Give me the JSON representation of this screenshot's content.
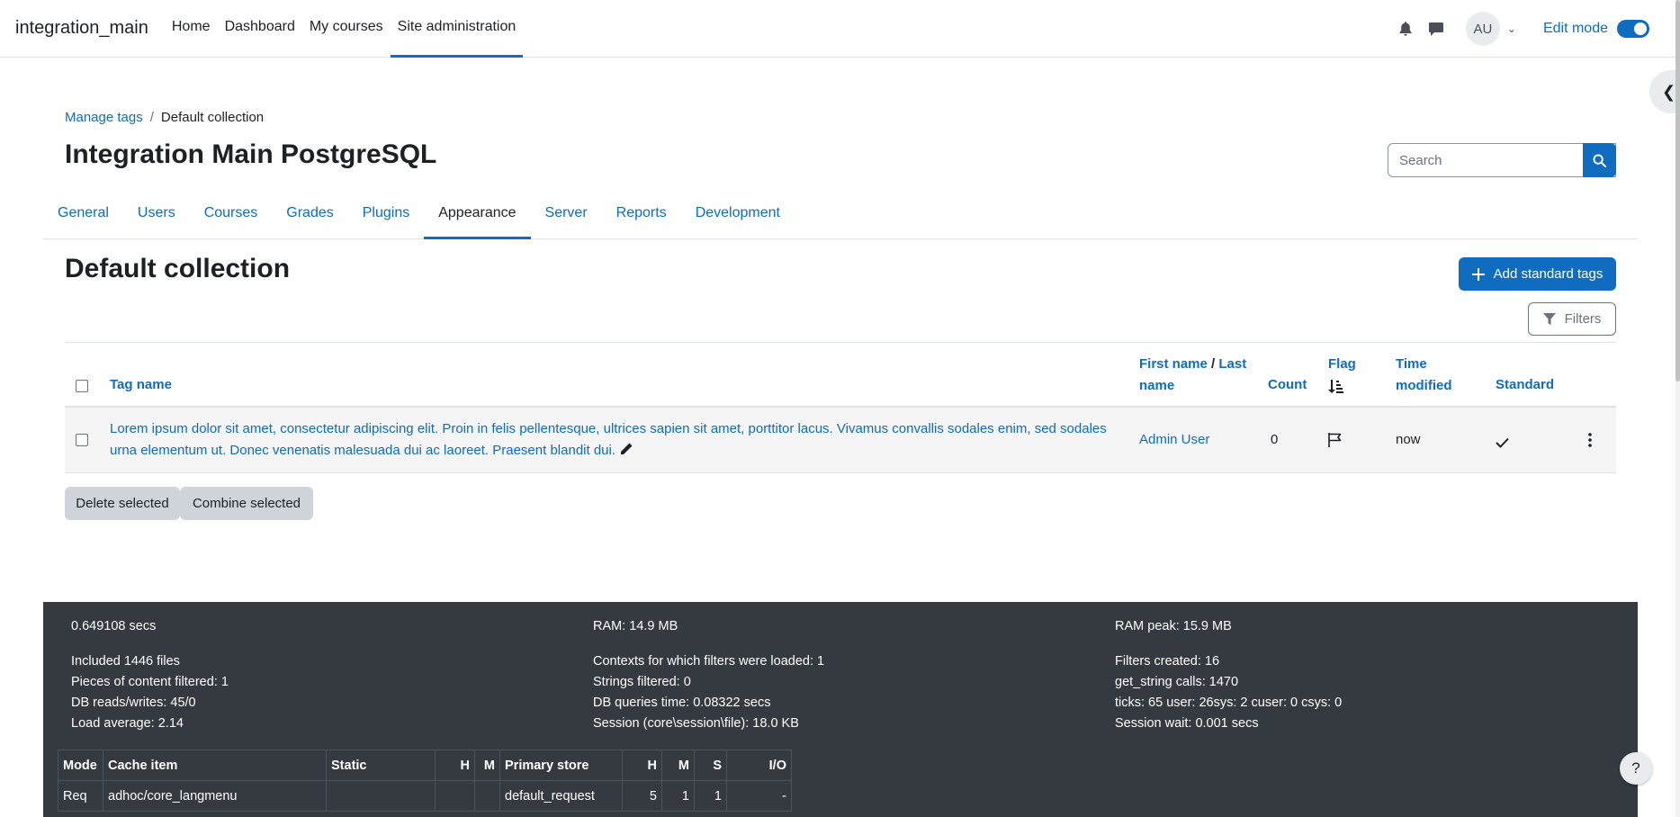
{
  "navbar": {
    "brand": "integration_main",
    "items": [
      {
        "label": "Home"
      },
      {
        "label": "Dashboard"
      },
      {
        "label": "My courses"
      },
      {
        "label": "Site administration"
      }
    ],
    "avatar_initials": "AU",
    "edit_mode_label": "Edit mode"
  },
  "breadcrumb": {
    "items": [
      "Manage tags",
      "Default collection"
    ],
    "separator": "/"
  },
  "header": {
    "title": "Integration Main PostgreSQL",
    "search_placeholder": "Search"
  },
  "secondary_nav": {
    "tabs": [
      "General",
      "Users",
      "Courses",
      "Grades",
      "Plugins",
      "Appearance",
      "Server",
      "Reports",
      "Development"
    ],
    "active": "Appearance"
  },
  "section": {
    "title": "Default collection",
    "add_button": "Add standard tags",
    "filters_button": "Filters"
  },
  "table": {
    "headers": {
      "tag_name": "Tag name",
      "first_name": "First name",
      "slash": "/",
      "last_name": "Last",
      "last_name2": "name",
      "count": "Count",
      "flag": "Flag",
      "time": "Time",
      "modified": "modified",
      "standard": "Standard"
    },
    "rows": [
      {
        "tag_line1": "Lorem ipsum dolor sit amet, consectetur adipiscing elit. Proin in felis pellentesque, ultrices sapien sit amet, porttitor lacus. Vivamus convallis sodales enim, sed sodales",
        "tag_line2": "urna elementum ut. Donec venenatis malesuada dui ac laoreet. Praesent blandit dui.",
        "user": "Admin User",
        "count": "0",
        "time_modified": "now"
      }
    ]
  },
  "bulk_actions": {
    "delete": "Delete selected",
    "combine": "Combine selected"
  },
  "perf": {
    "col1": [
      "0.649108 secs",
      "",
      "Included 1446 files",
      "Pieces of content filtered: 1",
      "DB reads/writes: 45/0",
      "Load average: 2.14"
    ],
    "col2": [
      "RAM: 14.9 MB",
      "",
      "Contexts for which filters were loaded: 1",
      "Strings filtered: 0",
      "DB queries time: 0.08322 secs",
      "Session (core\\session\\file): 18.0 KB"
    ],
    "col3": [
      "RAM peak: 15.9 MB",
      "",
      "Filters created: 16",
      "get_string calls: 1470",
      "ticks: 65 user: 26sys: 2 cuser: 0 csys: 0",
      "Session wait: 0.001 secs"
    ],
    "cache_headers": [
      "Mode",
      "Cache item",
      "Static",
      "H",
      "M",
      "Primary store",
      "H",
      "M",
      "S",
      "I/O"
    ],
    "cache_rows": [
      [
        "Req",
        "adhoc/core_langmenu",
        "",
        "",
        "",
        "default_request",
        "5",
        "1",
        "1",
        "-"
      ]
    ]
  },
  "help_label": "?"
}
